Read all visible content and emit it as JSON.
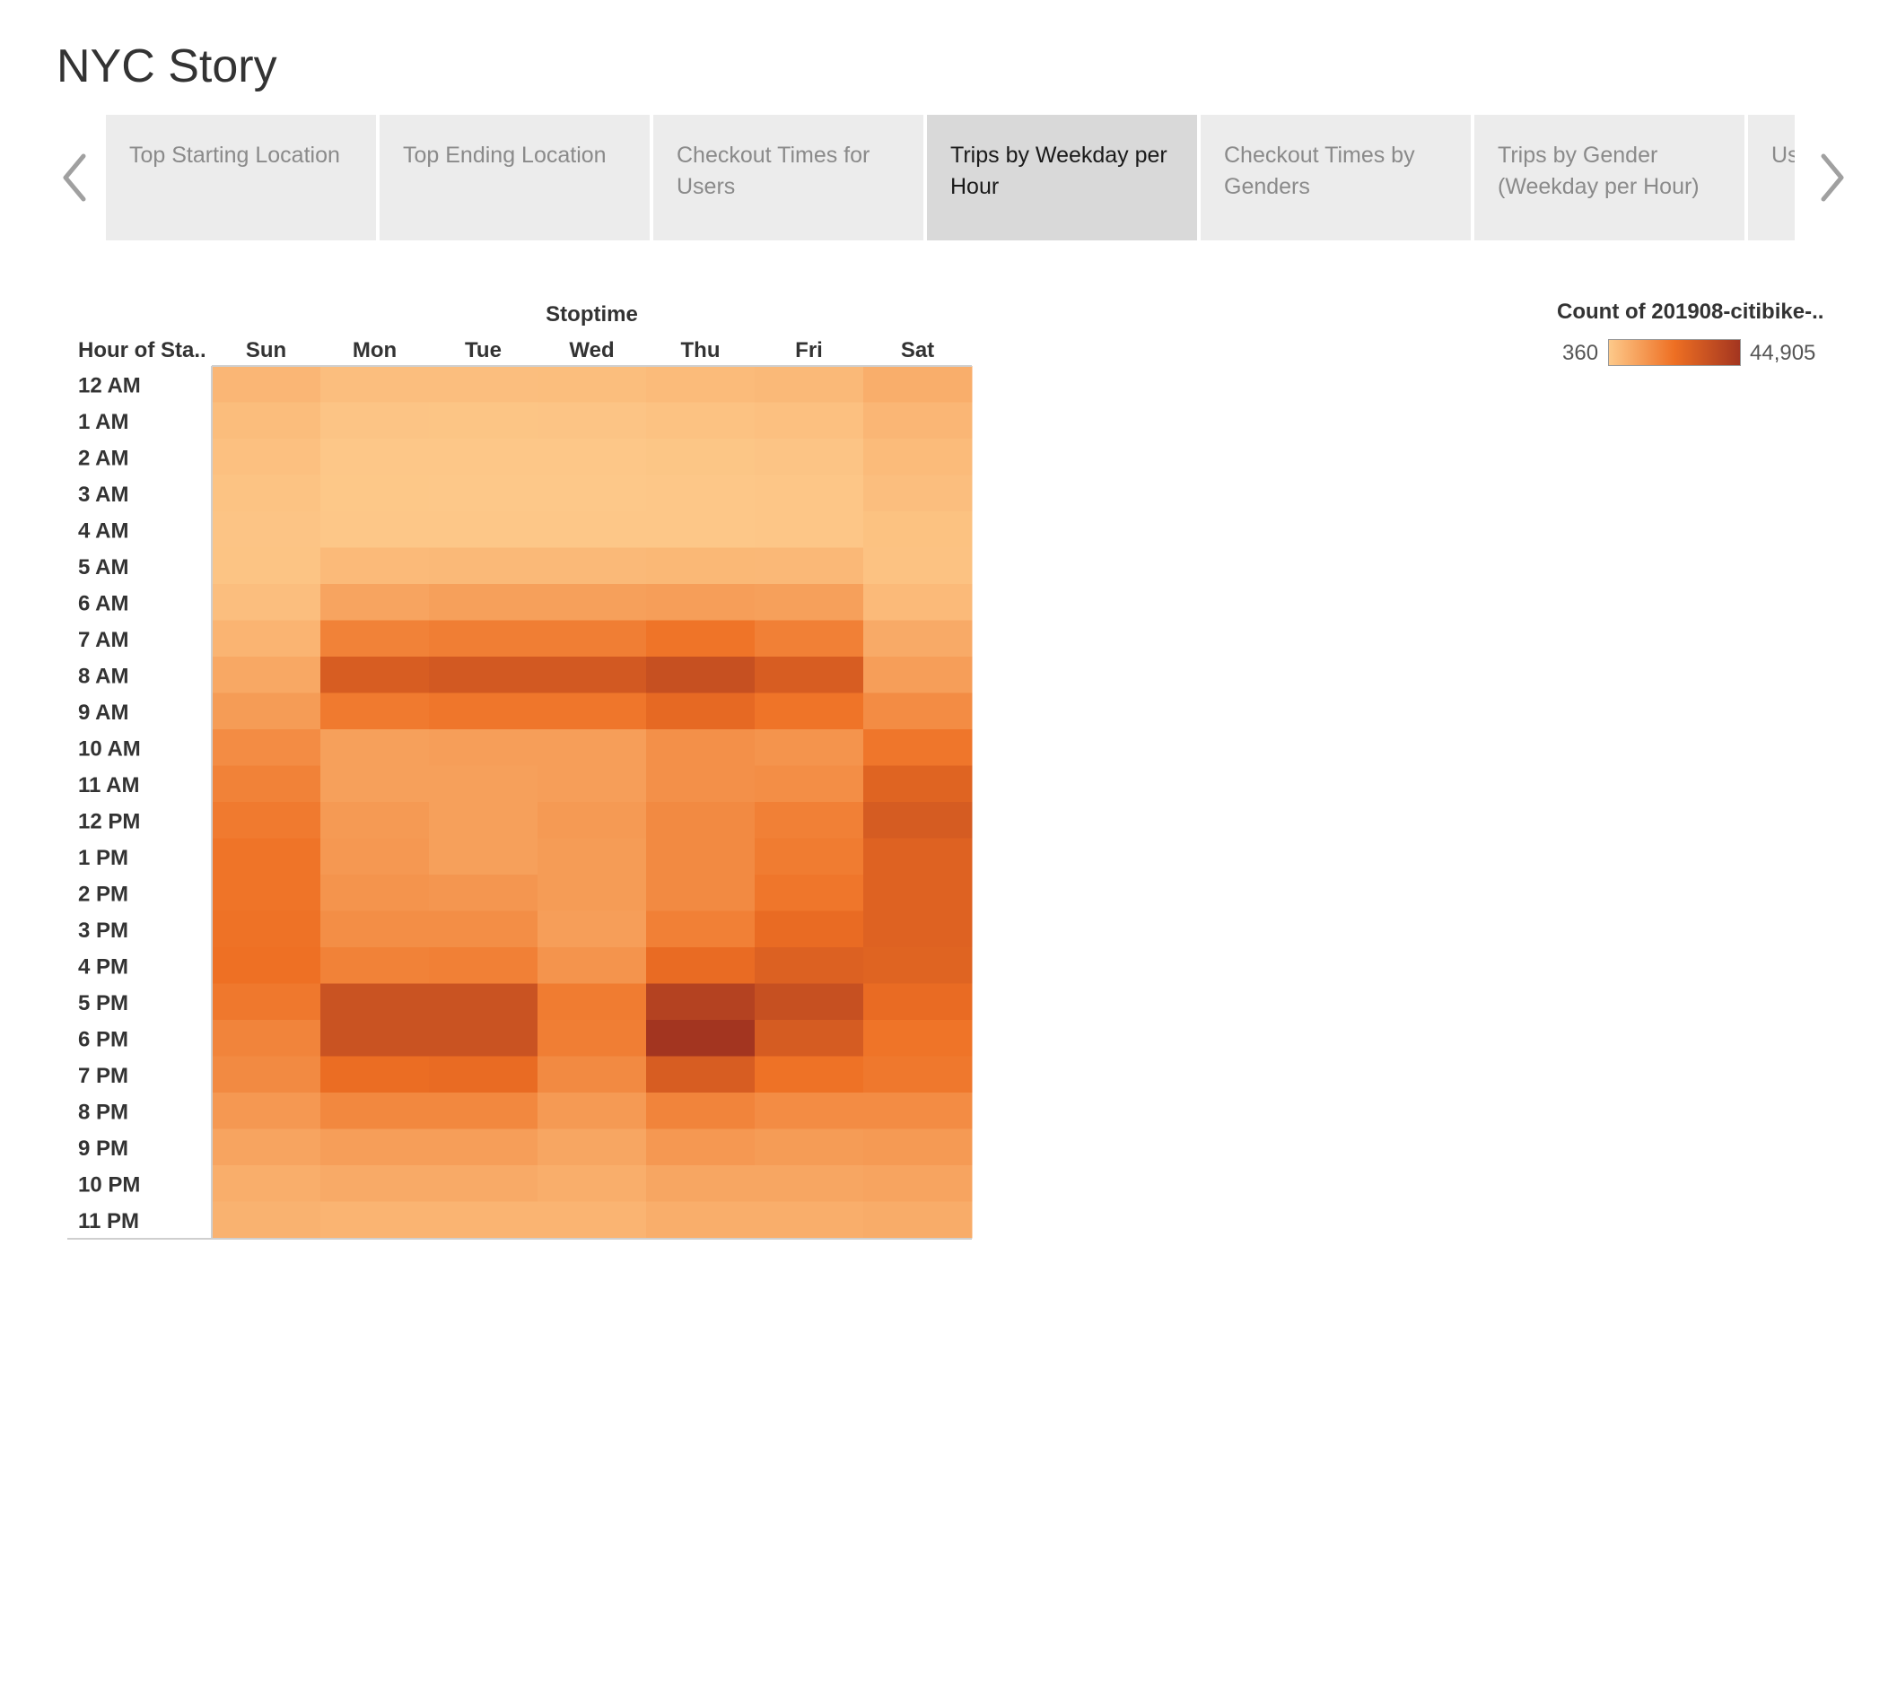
{
  "story": {
    "title": "NYC Story",
    "points": [
      {
        "label": "Top Starting Location",
        "active": false
      },
      {
        "label": "Top Ending Location",
        "active": false
      },
      {
        "label": "Checkout Times for Users",
        "active": false
      },
      {
        "label": "Trips  by Weekday per Hour",
        "active": true
      },
      {
        "label": "Checkout Times by Genders",
        "active": false
      },
      {
        "label": "Trips by Gender (Weekday per Hour)",
        "active": false
      },
      {
        "label": "Us by",
        "active": false
      }
    ]
  },
  "colors": {
    "ramp_low": "#fdc98a",
    "ramp_mid": "#ee6f23",
    "ramp_high": "#a33520",
    "tab_bg": "#ececec",
    "tab_active_bg": "#d9d9d9"
  },
  "icons": {
    "prev": "chevron-left-icon",
    "next": "chevron-right-icon"
  },
  "legend": {
    "title": "Count of 201908-citibike-..",
    "min_label": "360",
    "max_label": "44,905",
    "min": 360,
    "max": 44905
  },
  "chart_data": {
    "type": "heatmap",
    "column_axis_title": "Stoptime",
    "row_axis_title": "Hour of Sta..",
    "columns": [
      "Sun",
      "Mon",
      "Tue",
      "Wed",
      "Thu",
      "Fri",
      "Sat"
    ],
    "rows": [
      "12 AM",
      "1 AM",
      "2 AM",
      "3 AM",
      "4 AM",
      "5 AM",
      "6 AM",
      "7 AM",
      "8 AM",
      "9 AM",
      "10 AM",
      "11 AM",
      "12 PM",
      "1 PM",
      "2 PM",
      "3 PM",
      "4 PM",
      "5 PM",
      "6 PM",
      "7 PM",
      "8 PM",
      "9 PM",
      "10 PM",
      "11 PM"
    ],
    "values": [
      [
        5000,
        3000,
        3000,
        3200,
        3800,
        4200,
        7000
      ],
      [
        3400,
        1500,
        1400,
        1500,
        2000,
        2500,
        5000
      ],
      [
        2500,
        900,
        800,
        900,
        1200,
        1500,
        3800
      ],
      [
        1800,
        700,
        600,
        650,
        800,
        1000,
        3000
      ],
      [
        1500,
        900,
        800,
        850,
        900,
        1000,
        2200
      ],
      [
        1600,
        4000,
        4200,
        4300,
        4600,
        4500,
        2000
      ],
      [
        3000,
        9500,
        10500,
        10500,
        11000,
        10500,
        4000
      ],
      [
        5500,
        18000,
        19000,
        19000,
        21500,
        18500,
        8000
      ],
      [
        8500,
        29500,
        31000,
        31000,
        34500,
        29500,
        11000
      ],
      [
        11500,
        20000,
        21000,
        21000,
        25000,
        21500,
        15500
      ],
      [
        15500,
        10500,
        11000,
        11000,
        14500,
        13500,
        21000
      ],
      [
        18000,
        10500,
        10500,
        11000,
        14500,
        15000,
        27000
      ],
      [
        20000,
        12000,
        10500,
        12000,
        16000,
        18500,
        30000
      ],
      [
        21500,
        12500,
        10500,
        11500,
        16000,
        19500,
        27500
      ],
      [
        21500,
        13500,
        13000,
        11500,
        16000,
        21000,
        27500
      ],
      [
        22000,
        15000,
        15000,
        11000,
        18500,
        24000,
        27500
      ],
      [
        22500,
        18000,
        18500,
        13500,
        24000,
        28000,
        27000
      ],
      [
        20500,
        33500,
        33500,
        19500,
        40000,
        34500,
        24000
      ],
      [
        17500,
        33500,
        33500,
        19000,
        44905,
        30000,
        21500
      ],
      [
        16000,
        23500,
        24000,
        16000,
        29500,
        22000,
        20500
      ],
      [
        12500,
        16500,
        16500,
        12000,
        17500,
        15500,
        15500
      ],
      [
        9500,
        11000,
        11000,
        9000,
        12500,
        11500,
        12000
      ],
      [
        7000,
        8000,
        8000,
        7000,
        9000,
        9000,
        9500
      ],
      [
        6000,
        5500,
        5500,
        5500,
        7000,
        7000,
        7500
      ]
    ]
  }
}
